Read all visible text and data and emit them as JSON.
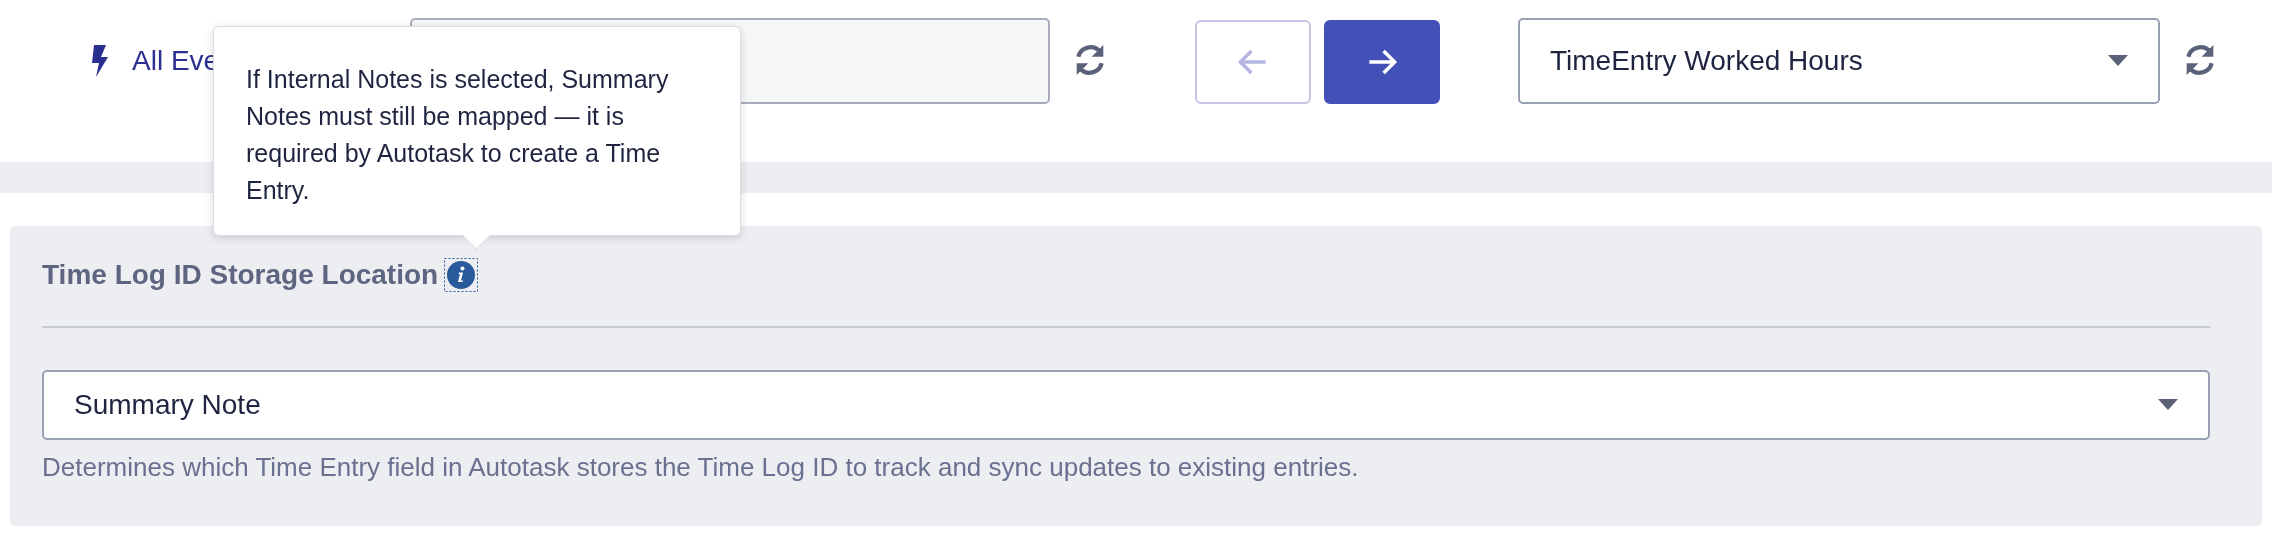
{
  "toolbar": {
    "event_filter": {
      "label": "All Eve"
    },
    "search_field": {
      "disabled": false
    },
    "back_button": {
      "disabled": true
    },
    "forward_button": {
      "disabled": false
    },
    "field_dropdown": {
      "value": "TimeEntry Worked Hours"
    }
  },
  "tooltip": {
    "text": "If Internal Notes is selected, Summary Notes must still be mapped — it is required by Autotask to create a Time Entry."
  },
  "panel": {
    "title": "Time Log ID Storage Location",
    "select": {
      "value": "Summary Note"
    },
    "help_text": "Determines which Time Entry field in Autotask stores the Time Log ID to track and sync updates to existing entries."
  }
}
